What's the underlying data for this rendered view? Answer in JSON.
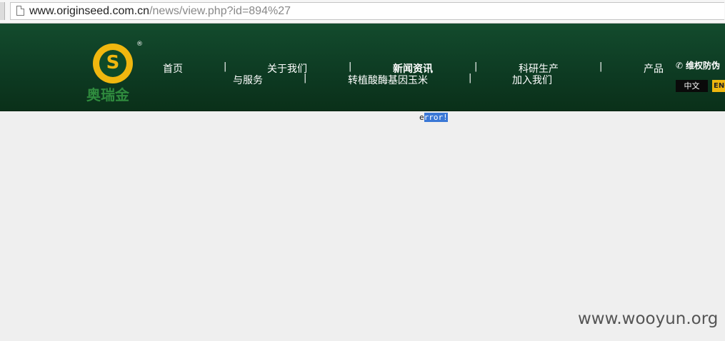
{
  "browser": {
    "url_host": "www.originseed.com.cn",
    "url_path": "/news/view.php?id=894%27"
  },
  "logo": {
    "letter": "S",
    "registered": "®",
    "brand": "奥瑞金"
  },
  "nav": {
    "items": [
      "首页",
      "关于我们",
      "新闻资讯",
      "科研生产",
      "产品与服务",
      "转植酸酶基因玉米",
      "加入我们"
    ],
    "product_part1": "产品",
    "product_part2": "与服务",
    "separator": "|"
  },
  "header_right": {
    "rights_label": "维权防伪",
    "lang_cn": "中文",
    "lang_en": "ENG"
  },
  "content": {
    "error_first": "e",
    "error_rest": "rror!"
  },
  "watermark": "www.wooyun.org",
  "colors": {
    "header_green": "#0d3a22",
    "accent_gold": "#f0b70f",
    "selection_blue": "#3a78d6"
  }
}
